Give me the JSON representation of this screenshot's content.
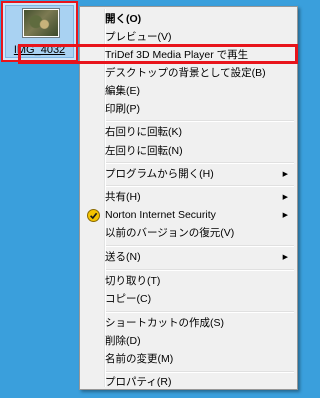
{
  "desktop_icon": {
    "label": "IMG_4032",
    "icon": "photo-thumbnail-icon"
  },
  "menu": {
    "items": [
      {
        "label": "開く(O)",
        "bold": true
      },
      {
        "label": "プレビュー(V)"
      },
      {
        "label": "TriDef 3D Media Player で再生"
      },
      {
        "label": "デスクトップの背景として設定(B)"
      },
      {
        "label": "編集(E)"
      },
      {
        "label": "印刷(P)"
      },
      {
        "label": "右回りに回転(K)"
      },
      {
        "label": "左回りに回転(N)"
      },
      {
        "label": "プログラムから開く(H)",
        "submenu": true
      },
      {
        "label": "共有(H)",
        "submenu": true
      },
      {
        "label": "Norton Internet Security",
        "submenu": true,
        "icon": "norton-icon"
      },
      {
        "label": "以前のバージョンの復元(V)"
      },
      {
        "label": "送る(N)",
        "submenu": true
      },
      {
        "label": "切り取り(T)"
      },
      {
        "label": "コピー(C)"
      },
      {
        "label": "ショートカットの作成(S)"
      },
      {
        "label": "削除(D)"
      },
      {
        "label": "名前の変更(M)"
      },
      {
        "label": "プロパティ(R)"
      }
    ],
    "submenu_arrow": "▶"
  },
  "colors": {
    "desktop": "#3a9fdc",
    "menu_bg": "#f0f0f0",
    "highlight_border": "#e8141b",
    "norton_yellow": "#f5c400"
  }
}
